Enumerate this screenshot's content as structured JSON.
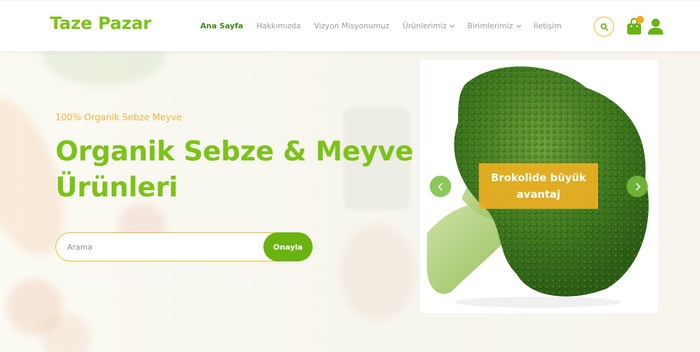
{
  "header": {
    "logo": "Taze Pazar",
    "nav": [
      {
        "label": "Ana Sayfa"
      },
      {
        "label": "Hakkımızda"
      },
      {
        "label": "Vizyon Misyonumuz"
      },
      {
        "label": "Ürünlerimiz"
      },
      {
        "label": "Birimlerimiz"
      },
      {
        "label": "İletişim"
      }
    ]
  },
  "hero": {
    "subtitle": "100% Organik Sebze Meyve",
    "title": "Organik Sebze & Meyve Ürünleri",
    "search": {
      "placeholder": "Arama",
      "button": "Onayla"
    }
  },
  "slider": {
    "caption": "Brokolide büyük avantaj"
  },
  "colors": {
    "brand_green": "#7cc21a",
    "accent_orange": "#f0b81c",
    "active_nav": "#3d8a1a"
  },
  "icons": [
    "search-icon",
    "shopping-bag-icon",
    "user-icon",
    "chevron-left-icon",
    "chevron-right-icon",
    "chevron-down-icon"
  ]
}
